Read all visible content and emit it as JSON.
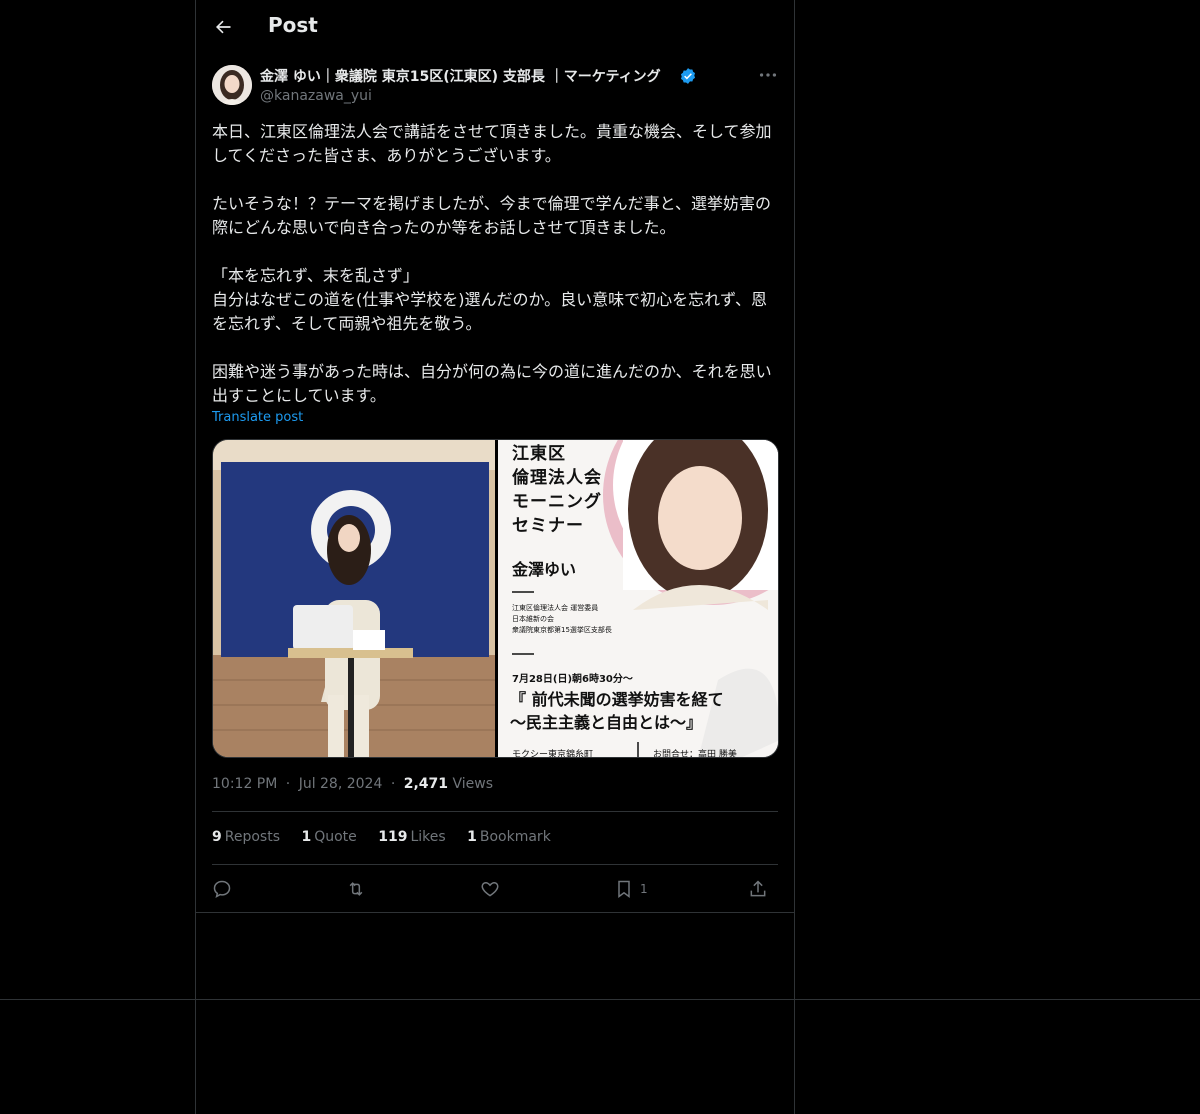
{
  "header": {
    "title": "Post"
  },
  "author": {
    "name": "金澤 ゆい｜衆議院 東京15区(江東区) 支部長 ｜マーケティング",
    "handle": "@kanazawa_yui"
  },
  "post": {
    "text": "本日、江東区倫理法人会で講話をさせて頂きました。貴重な機会、そして参加してくださった皆さま、ありがとうございます。\n\nたいそうな！？テーマを掲げましたが、今まで倫理で学んだ事と、選挙妨害の際にどんな思いで向き合ったのか等をお話しさせて頂きました。\n\n「本を忘れず、末を乱さず」\n自分はなぜこの道を(仕事や学校を)選んだのか。良い意味で初心を忘れず、恩を忘れず、そして両親や祖先を敬う。\n\n困難や迷う事があった時は、自分が何の為に今の道に進んだのか、それを思い出すことにしています。",
    "translate_label": "Translate post"
  },
  "poster": {
    "title": "江東区\n倫理法人会\nモーニング\nセミナー",
    "name": "金澤ゆい",
    "roles": "江東区倫理法人会 運営委員\n日本維新の会\n衆議院東京都第15選挙区支部長",
    "date": "7月28日(日)朝6時30分〜",
    "theme": "『 前代未聞の選挙妨害を経て\n〜民主主義と自由とは〜』",
    "bottom_left": "モクシー東京錦糸町",
    "bottom_right": "お問合せ：高田 勝美"
  },
  "meta": {
    "time": "10:12 PM",
    "date": "Jul 28, 2024",
    "views_count": "2,471",
    "views_label": "Views",
    "sep": "·"
  },
  "stats": {
    "reposts_count": "9",
    "reposts_label": "Reposts",
    "quotes_count": "1",
    "quotes_label": "Quote",
    "likes_count": "119",
    "likes_label": "Likes",
    "bookmarks_count": "1",
    "bookmarks_label": "Bookmark"
  },
  "actions": {
    "bookmark_count": "1"
  },
  "colors": {
    "background": "#000000",
    "accent": "#1d9bf0",
    "muted": "#71767b",
    "border": "#2f3336"
  },
  "icons": [
    "back-arrow-icon",
    "verified-badge-icon",
    "more-icon",
    "reply-icon",
    "repost-icon",
    "like-icon",
    "bookmark-icon",
    "share-icon"
  ]
}
